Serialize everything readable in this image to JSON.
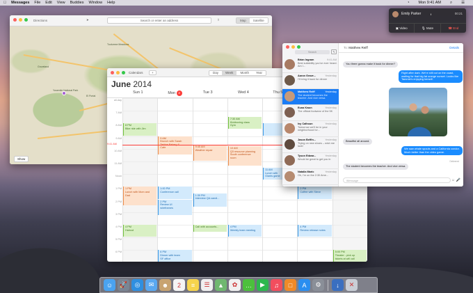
{
  "menubar": {
    "apple": "",
    "app": "Messages",
    "items": [
      "File",
      "Edit",
      "View",
      "Buddies",
      "Window",
      "Help"
    ],
    "time": "Mon 9:41 AM"
  },
  "maps": {
    "directions": "Directions",
    "search_placeholder": "Search or enter an address",
    "map": "Map",
    "satellite": "Satellite",
    "show": "Show",
    "places": [
      {
        "t": "Yosemite National Park",
        "k": "a"
      },
      {
        "t": "Groveland",
        "k": "b"
      },
      {
        "t": "Mariposa",
        "k": "c"
      },
      {
        "t": "Oakhurst",
        "k": "d"
      },
      {
        "t": "El Portal",
        "k": "e"
      },
      {
        "t": "Wawona",
        "k": "f"
      },
      {
        "t": "Tuolumne Meadows",
        "k": "g"
      }
    ]
  },
  "calendar": {
    "title": "Calendars",
    "add": "+",
    "views": [
      "Day",
      "Week",
      "Month",
      "Year"
    ],
    "active_view": "Week",
    "month": "June",
    "year": "2014",
    "days": [
      "Sun 1",
      "Mon",
      "Tue 3",
      "Wed 4",
      "Thu 5",
      "Fri 6",
      "Sat 7"
    ],
    "today_num": "2",
    "hours": [
      "all-day",
      "7 AM",
      "8 AM",
      "9 AM",
      "10 AM",
      "11 AM",
      "Noon",
      "1 PM",
      "2 PM",
      "3 PM",
      "4 PM",
      "5 PM",
      "6 PM",
      "7 PM"
    ],
    "now": "9:41 AM",
    "events": [
      {
        "d": 0,
        "s": 8,
        "e": 9,
        "c": "g",
        "t": "8 PM\nBike ride with Jim"
      },
      {
        "d": 1,
        "s": 9,
        "e": 10.5,
        "c": "o",
        "t": "9 AM\nBrunch with Sarah\nTartine Bakery &\nCafe"
      },
      {
        "d": 2,
        "s": 9.7,
        "e": 11,
        "c": "o",
        "t": "9:45 AM\nWeather repair"
      },
      {
        "d": 3,
        "s": 7.5,
        "e": 8.5,
        "c": "g",
        "t": "7:30 AM\nKickboxing class\nGym"
      },
      {
        "d": 3,
        "s": 9.8,
        "e": 11.4,
        "c": "o",
        "t": "10 AM\nQ3 resource planning\nSouth conference\nroom"
      },
      {
        "d": 4,
        "s": 8,
        "e": 9,
        "c": "b",
        "t": ""
      },
      {
        "d": 4,
        "s": 11.5,
        "e": 12.5,
        "c": "b",
        "t": "11 AM\nLunch with\nGiants game"
      },
      {
        "d": 5,
        "s": 11.2,
        "e": 12.4,
        "c": "g",
        "t": "11 AM\nGiants game"
      },
      {
        "d": 0,
        "s": 13,
        "e": 14.5,
        "c": "o",
        "t": "1 PM\nLunch with Mom and\nDad"
      },
      {
        "d": 1,
        "s": 13,
        "e": 14,
        "c": "b",
        "t": "1:00 PM\nConference call"
      },
      {
        "d": 1,
        "s": 14,
        "e": 15.3,
        "c": "b",
        "t": "2 PM\nReview UI\nwireframes"
      },
      {
        "d": 2,
        "s": 13.5,
        "e": 14.6,
        "c": "b",
        "t": "1:30 PM\nInterview QA candi..."
      },
      {
        "d": 5,
        "s": 13,
        "e": 14,
        "c": "b",
        "t": "2 PM\nCoffee with Steve"
      },
      {
        "d": 0,
        "s": 16,
        "e": 17,
        "c": "g",
        "t": "4 PM\nHaircut"
      },
      {
        "d": 2,
        "s": 16,
        "e": 16.6,
        "c": "g",
        "t": "Call with accounts..."
      },
      {
        "d": 3,
        "s": 16,
        "e": 17,
        "c": "b",
        "t": "4 PM\nWeekly team meeting"
      },
      {
        "d": 5,
        "s": 16,
        "e": 17,
        "c": "b",
        "t": "4 PM\nReview release notes"
      },
      {
        "d": 1,
        "s": 18,
        "e": 19.5,
        "c": "b",
        "t": "6 PM\nDinner with team\nSF office"
      },
      {
        "d": 6,
        "s": 18,
        "e": 19.5,
        "c": "g",
        "t": "5:00 PM\nTheater - pick up\ntickets at will call"
      }
    ]
  },
  "messages": {
    "search": "Search",
    "compose": "✎",
    "to_label": "To:",
    "to": "Matthew Reiff",
    "details": "Details",
    "input_placeholder": "iMessage",
    "delivered": "Delivered",
    "convs": [
      {
        "n": "Brian Ingram",
        "t": "9:41 AM",
        "p": "Best suitability you’ve ever heard. Am I…",
        "c": "#a77a62"
      },
      {
        "n": "Aaron Grave...",
        "t": "Yesterday",
        "p": "I'll bring it back for dinner",
        "c": "#6e5a4a"
      },
      {
        "n": "Matthew Reiff",
        "t": "Yesterday",
        "p": "The student becomes the teacher. And vice versa.",
        "c": "#c69a7a"
      },
      {
        "n": "Euna Kwon",
        "t": "Yesterday",
        "p": "The official footwear of the 5K",
        "c": "#7d6052"
      },
      {
        "n": "Ivy Calhoun",
        "t": "Yesterday",
        "p": "Tomorrow we'll be in your neighborhood for…",
        "c": "#b8876c"
      },
      {
        "n": "Jason Beffin...",
        "t": "Yesterday",
        "p": "Trying on new shoes – wish me luck!",
        "c": "#5e4b3f"
      },
      {
        "n": "Tyson Edwar...",
        "t": "Yesterday",
        "p": "Would be great to get you in",
        "c": "#8f6a56"
      },
      {
        "n": "Natalia Maric",
        "t": "Yesterday",
        "p": "Oh, I'm on the 2:30 Ame...",
        "c": "#b68b70"
      }
    ],
    "bubbles": [
      {
        "k": "in",
        "t": "You three gonna make it back for dinner?"
      },
      {
        "k": "out",
        "t": "Right after dark. We're still out on the coast, waiting for that big fat orange sunset. Looks like Tammie's enjoying herself."
      },
      {
        "k": "in",
        "t": "Beautiful all around."
      },
      {
        "k": "out",
        "t": "We saw whale spouts and a California condor. Much better than the video game."
      },
      {
        "k": "in",
        "t": "The student becomes the teacher. And vice versa."
      }
    ]
  },
  "call": {
    "name": "Emily Parker",
    "time": "00:21",
    "video": "Video",
    "mute": "Mute",
    "end": "End"
  },
  "dock": [
    {
      "n": "finder",
      "c": "#4aa3f0",
      "g": "☺"
    },
    {
      "n": "launchpad",
      "c": "#7a8593",
      "g": "🚀"
    },
    {
      "n": "safari",
      "c": "#2f8fe0",
      "g": "◎"
    },
    {
      "n": "mail",
      "c": "#5aa8f0",
      "g": "✉"
    },
    {
      "n": "contacts",
      "c": "#c8a370",
      "g": "☻"
    },
    {
      "n": "calendar",
      "c": "#f4f4f4",
      "g": "2"
    },
    {
      "n": "notes",
      "c": "#f6d44d",
      "g": "≡"
    },
    {
      "n": "reminders",
      "c": "#f0f0f0",
      "g": "☰"
    },
    {
      "n": "maps",
      "c": "#70b870",
      "g": "▲"
    },
    {
      "n": "photos",
      "c": "#f0f0f0",
      "g": "✿"
    },
    {
      "n": "messages",
      "c": "#4cc03c",
      "g": "…"
    },
    {
      "n": "facetime",
      "c": "#2cb84e",
      "g": "▶"
    },
    {
      "n": "itunes",
      "c": "#f24e5e",
      "g": "♫"
    },
    {
      "n": "ibooks",
      "c": "#f08a28",
      "g": "□"
    },
    {
      "n": "app-store",
      "c": "#2a8ef0",
      "g": "A"
    },
    {
      "n": "system-preferences",
      "c": "#8a8f98",
      "g": "⚙"
    },
    {
      "n": "downloads",
      "c": "#3a6fc0",
      "g": "↓"
    },
    {
      "n": "trash",
      "c": "#c9ced6",
      "g": "✕"
    }
  ]
}
